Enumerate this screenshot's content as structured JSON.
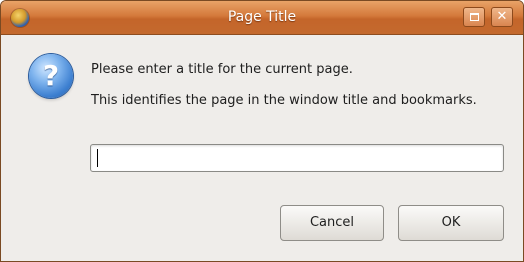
{
  "window": {
    "title": "Page Title",
    "controls": {
      "maximize_icon": "maximize-icon",
      "close_label": "✕"
    }
  },
  "dialog": {
    "icon": "question-icon",
    "icon_glyph": "?",
    "message_line1": "Please enter a title for the current page.",
    "message_line2": "This identifies the page in the window title and bookmarks.",
    "input": {
      "value": "",
      "placeholder": ""
    },
    "buttons": {
      "cancel_label": "Cancel",
      "ok_label": "OK"
    }
  },
  "colors": {
    "titlebar": "#d4793b",
    "window_bg": "#efedea",
    "question_icon": "#3c7fd0"
  }
}
